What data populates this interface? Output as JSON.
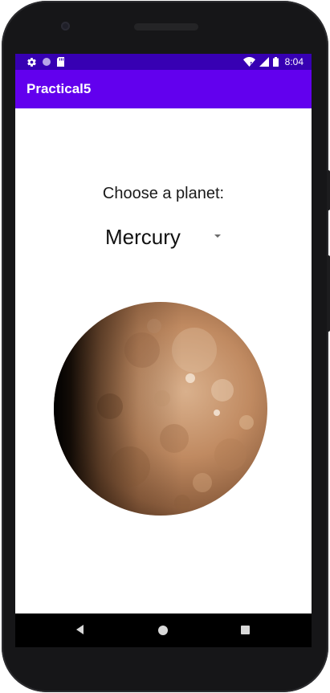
{
  "status_bar": {
    "time": "8:04",
    "left_icons": [
      "gear-icon",
      "circle-icon",
      "sd-card-icon"
    ],
    "right_icons": [
      "wifi-icon",
      "signal-icon",
      "battery-icon"
    ],
    "color": "#3700b3"
  },
  "app_bar": {
    "title": "Practical5",
    "color": "#6200ee"
  },
  "main": {
    "prompt": "Choose a planet:",
    "spinner": {
      "selected": "Mercury"
    },
    "image": {
      "name": "mercury-planet-image"
    }
  },
  "nav_bar": {
    "buttons": [
      "back-icon",
      "home-icon",
      "recents-icon"
    ]
  }
}
